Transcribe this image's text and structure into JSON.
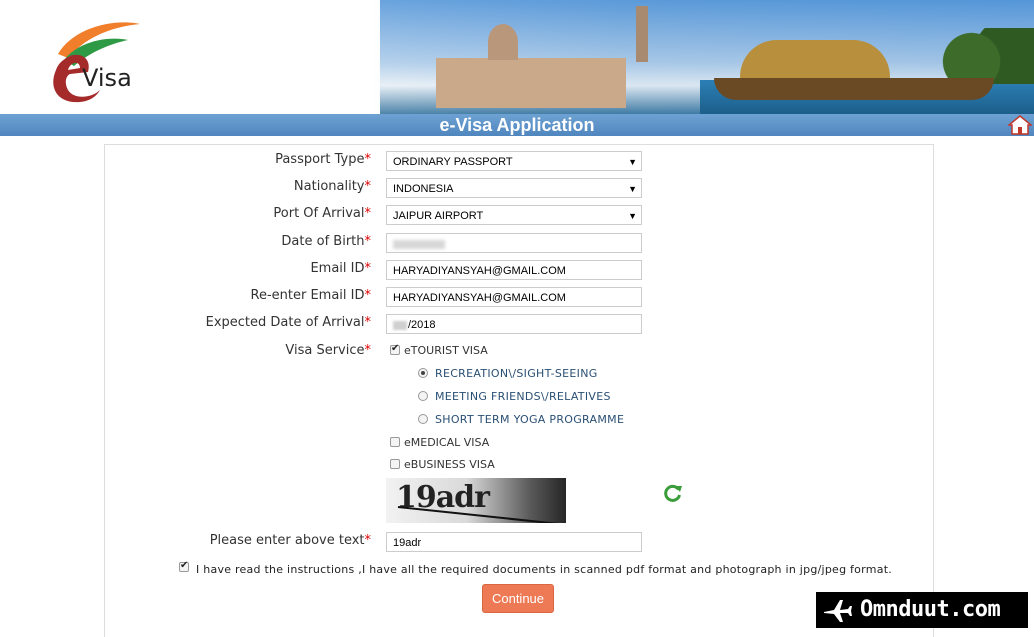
{
  "banner": {
    "logo_text": "Visa"
  },
  "header": {
    "title": "e-Visa Application"
  },
  "form": {
    "passport_type": {
      "label": "Passport Type",
      "value": "ORDINARY PASSPORT"
    },
    "nationality": {
      "label": "Nationality",
      "value": "INDONESIA"
    },
    "port_of_arrival": {
      "label": "Port Of Arrival",
      "value": "JAIPUR AIRPORT"
    },
    "date_of_birth": {
      "label": "Date of Birth"
    },
    "email": {
      "label": "Email ID",
      "value": "HARYADIYANSYAH@GMAIL.COM"
    },
    "reenter_email": {
      "label": "Re-enter Email ID",
      "value": "HARYADIYANSYAH@GMAIL.COM"
    },
    "expected_arrival": {
      "label": "Expected Date of Arrival",
      "value": "/2018"
    },
    "visa_service": {
      "label": "Visa Service",
      "etourist": {
        "label": "eTOURIST VISA",
        "checked": true
      },
      "purposes": [
        {
          "label": "RECREATION\\/SIGHT-SEEING",
          "selected": true
        },
        {
          "label": "MEETING FRIENDS\\/RELATIVES",
          "selected": false
        },
        {
          "label": "SHORT TERM YOGA PROGRAMME",
          "selected": false
        }
      ],
      "emedical": {
        "label": "eMEDICAL VISA",
        "checked": false
      },
      "ebusiness": {
        "label": "eBUSINESS VISA",
        "checked": false
      }
    },
    "captcha": {
      "image_text": "19adr",
      "label": "Please enter above text",
      "value": "19adr"
    },
    "instructions": {
      "text": "I have read the instructions ,I have all the required documents in scanned pdf format and photograph in jpg/jpeg format.",
      "checked": true
    },
    "continue_label": "Continue"
  },
  "required_mark": "*",
  "watermark": {
    "text": "Omnduut.com"
  },
  "colors": {
    "title_bar": "#5b93c9",
    "continue_button": "#ee7a55",
    "required": "#dd0000",
    "refresh": "#3a9d3a"
  }
}
